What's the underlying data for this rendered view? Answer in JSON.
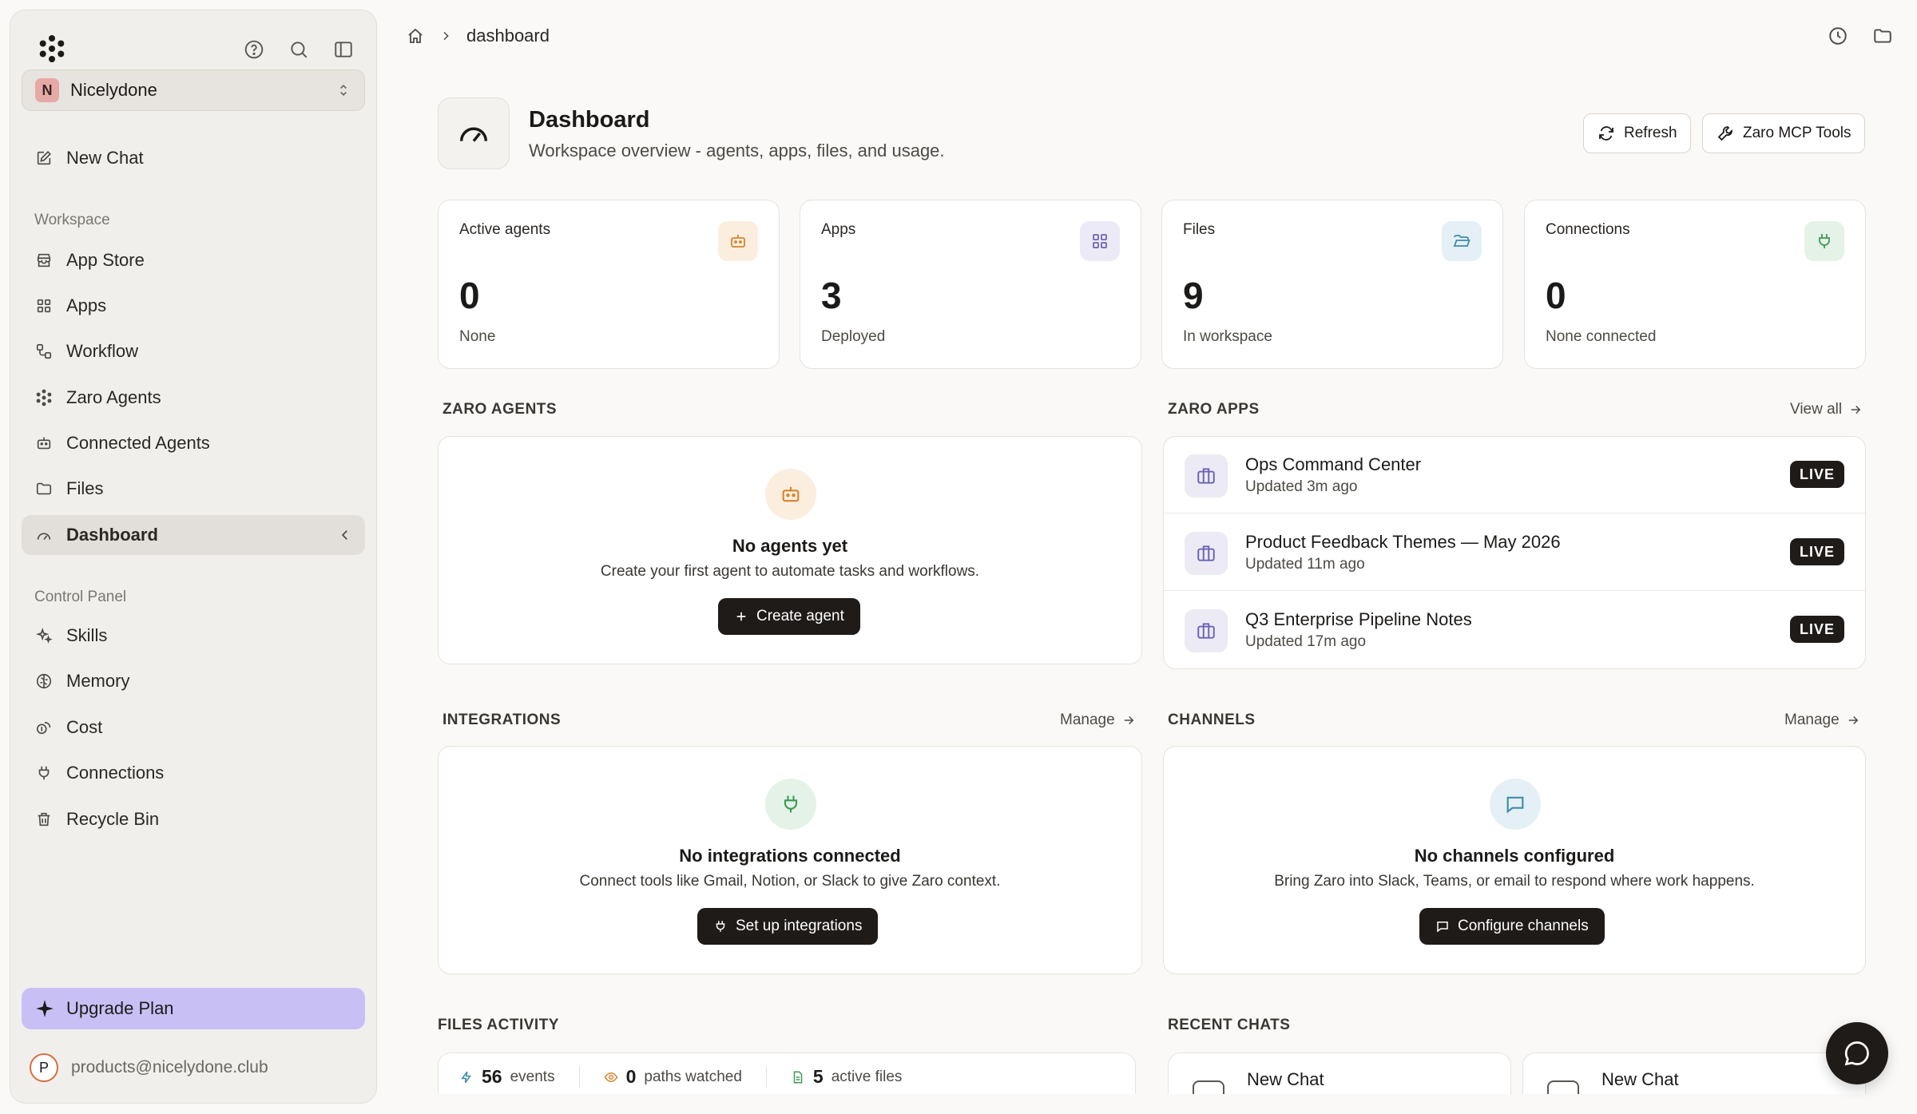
{
  "sidebar": {
    "workspace_initial": "N",
    "workspace_name": "Nicelydone",
    "new_chat": "New Chat",
    "workspace_label": "Workspace",
    "workspace_items": [
      "App Store",
      "Apps",
      "Workflow",
      "Zaro Agents",
      "Connected Agents",
      "Files",
      "Dashboard"
    ],
    "control_label": "Control Panel",
    "control_items": [
      "Skills",
      "Memory",
      "Cost",
      "Connections",
      "Recycle Bin"
    ],
    "upgrade": "Upgrade Plan",
    "account_initial": "P",
    "account_email": "products@nicelydone.club"
  },
  "breadcrumb": {
    "current": "dashboard"
  },
  "header": {
    "title": "Dashboard",
    "subtitle": "Workspace overview - agents, apps, files, and usage.",
    "refresh": "Refresh",
    "mcp": "Zaro MCP Tools"
  },
  "stats": [
    {
      "label": "Active agents",
      "value": "0",
      "sub": "None",
      "color": "#d9822b"
    },
    {
      "label": "Apps",
      "value": "3",
      "sub": "Deployed",
      "color": "#6b64b5"
    },
    {
      "label": "Files",
      "value": "9",
      "sub": "In workspace",
      "color": "#3f8aa8"
    },
    {
      "label": "Connections",
      "value": "0",
      "sub": "None connected",
      "color": "#3e9a55"
    }
  ],
  "agents": {
    "section": "ZARO AGENTS",
    "title": "No agents yet",
    "subtitle": "Create your first agent to automate tasks and workflows.",
    "button": "Create agent"
  },
  "apps": {
    "section": "ZARO APPS",
    "view_all": "View all",
    "items": [
      {
        "name": "Ops Command Center",
        "updated": "Updated 3m ago",
        "badge": "LIVE"
      },
      {
        "name": "Product Feedback Themes — May 2026",
        "updated": "Updated 11m ago",
        "badge": "LIVE"
      },
      {
        "name": "Q3 Enterprise Pipeline Notes",
        "updated": "Updated 17m ago",
        "badge": "LIVE"
      }
    ]
  },
  "integrations": {
    "section": "INTEGRATIONS",
    "manage": "Manage",
    "title": "No integrations connected",
    "subtitle": "Connect tools like Gmail, Notion, or Slack to give Zaro context.",
    "button": "Set up integrations"
  },
  "channels": {
    "section": "CHANNELS",
    "manage": "Manage",
    "title": "No channels configured",
    "subtitle": "Bring Zaro into Slack, Teams, or email to respond where work happens.",
    "button": "Configure channels"
  },
  "files_activity": {
    "section": "FILES ACTIVITY",
    "events_value": "56",
    "events_label": "events",
    "paths_value": "0",
    "paths_label": "paths watched",
    "active_value": "5",
    "active_label": "active files"
  },
  "recent_chats": {
    "section": "RECENT CHATS",
    "items": [
      "New Chat",
      "New Chat"
    ]
  }
}
